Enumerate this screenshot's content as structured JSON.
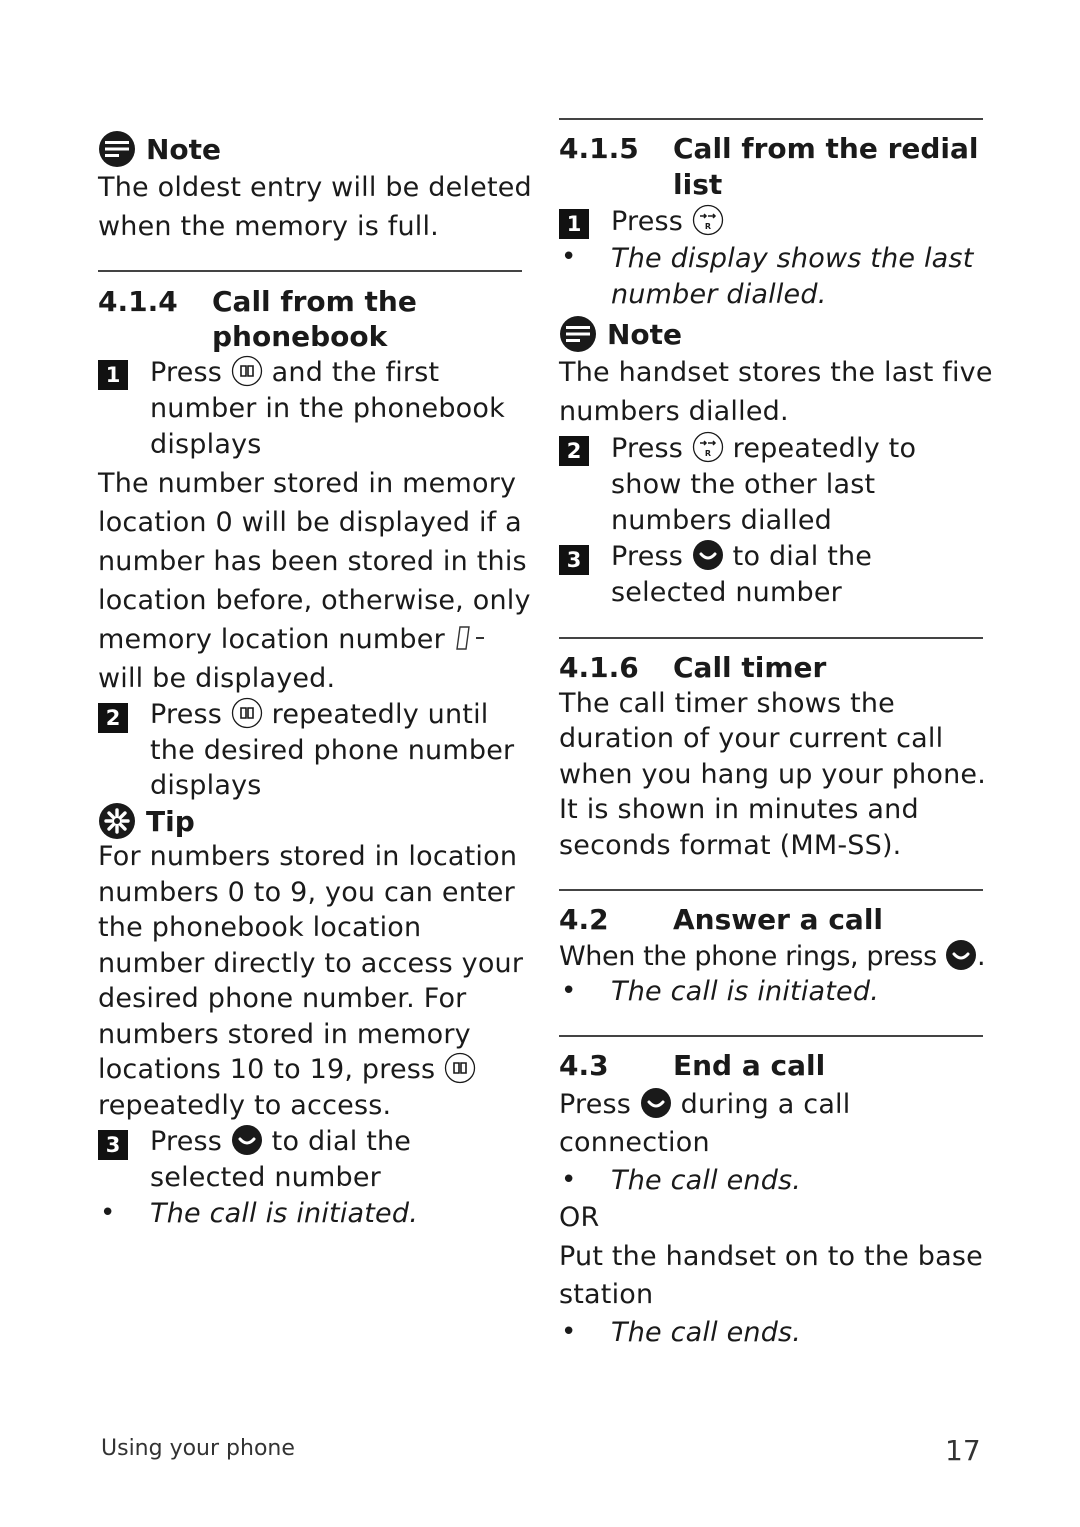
{
  "left_column": {
    "note1": {
      "icon": "note-icon",
      "title": "Note",
      "lines": [
        "The oldest entry will be deleted",
        "when the memory is full."
      ]
    },
    "section_4_1_4": {
      "number": "4.1.4",
      "title_lines": [
        "Call from the",
        "phonebook"
      ],
      "step1": {
        "badge": "1",
        "line1_before": "Press",
        "line1_icon": "phonebook-button-icon",
        "line1_after": "and the first",
        "lines": [
          "number in the phonebook",
          "displays"
        ]
      },
      "paragraph": [
        "The number stored in memory",
        "location 0 will be displayed if a",
        "number has been stored in this",
        "location before, otherwise, only",
        "memory location number",
        "will be displayed."
      ],
      "lcd_glyph": "0-",
      "step2": {
        "badge": "2",
        "line1_before": "Press",
        "line1_icon": "phonebook-button-icon",
        "line1_after": "repeatedly until",
        "lines": [
          "the desired phone number",
          "displays"
        ]
      },
      "tip": {
        "icon": "tip-icon",
        "title": "Tip",
        "lines": [
          "For numbers stored in location",
          "numbers 0 to 9, you can enter",
          "the phonebook location",
          "number directly to access your",
          "desired phone number. For",
          "numbers stored in memory",
          "locations 10 to 19, press",
          "repeatedly to access."
        ]
      },
      "step3": {
        "badge": "3",
        "line1_before": "Press",
        "line1_icon": "talk-button-icon",
        "line1_after": "to dial the",
        "lines": [
          "selected number"
        ]
      },
      "result": "The call is initiated."
    }
  },
  "right_column": {
    "section_4_1_5": {
      "number": "4.1.5",
      "title_lines": [
        "Call from the redial",
        "list"
      ],
      "step1": {
        "badge": "1",
        "line1_before": "Press",
        "line1_icon": "redial-button-icon"
      },
      "result_lines": [
        "The display shows the last",
        "number dialled."
      ],
      "note": {
        "title": "Note",
        "lines": [
          "The handset stores the last five",
          "numbers dialled."
        ]
      },
      "step2": {
        "badge": "2",
        "line1_before": "Press",
        "line1_icon": "redial-button-icon",
        "line1_after": "repeatedly to",
        "lines": [
          "show the other last",
          "numbers dialled"
        ]
      },
      "step3": {
        "badge": "3",
        "line1_before": "Press",
        "line1_icon": "talk-button-icon",
        "line1_after": "to dial the",
        "lines": [
          "selected number"
        ]
      }
    },
    "section_4_1_6": {
      "number": "4.1.6",
      "title": "Call timer",
      "lines": [
        "The call timer shows the",
        "duration of your current call",
        "when you hang up your phone.",
        "It is shown in minutes and",
        "seconds format (MM-SS)."
      ]
    },
    "section_4_2": {
      "number": "4.2",
      "title": "Answer a call",
      "line_before": "When the phone rings, press",
      "line_after": ".",
      "result": "The call is initiated."
    },
    "section_4_3": {
      "number": "4.3",
      "title": "End a call",
      "line1_before": "Press",
      "line1_after": "during a call",
      "line2": "connection",
      "result1": "The call ends.",
      "or": "OR",
      "alt_lines": [
        "Put the handset on to the base",
        "station"
      ],
      "result2": "The call ends."
    }
  },
  "footer": {
    "section_name": "Using your phone",
    "page_number": "17"
  }
}
